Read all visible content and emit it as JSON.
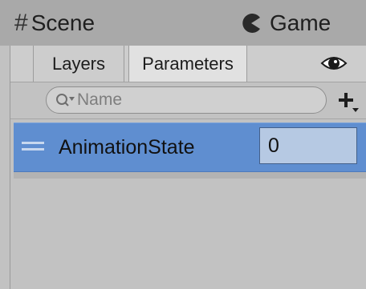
{
  "top_tabs": [
    {
      "label": "Scene",
      "icon": "scene-hash-icon"
    },
    {
      "label": "Game",
      "icon": "game-pacman-icon"
    }
  ],
  "panel": {
    "tabs": [
      {
        "label": "Layers"
      },
      {
        "label": "Parameters",
        "active": true
      }
    ],
    "eye_icon": "eye-icon",
    "search": {
      "placeholder": "Name"
    },
    "add_icon": "plus-icon",
    "parameters": [
      {
        "name": "AnimationState",
        "value": "0"
      }
    ]
  },
  "colors": {
    "selected_row": "#5f8ed0",
    "value_field": "#b6c9e3",
    "panel_bg": "#c2c2c2",
    "tabbar_bg": "#a9a9a9"
  }
}
